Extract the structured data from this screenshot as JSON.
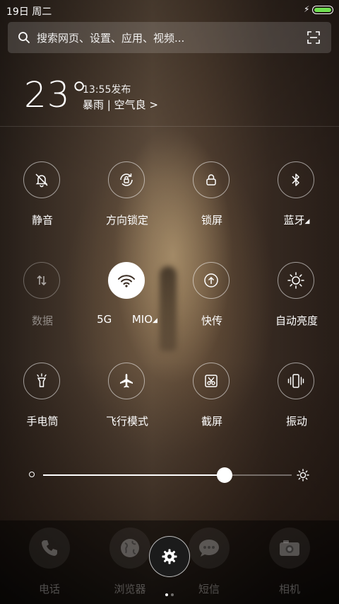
{
  "status_bar": {
    "date_day": "19日 周二"
  },
  "search": {
    "placeholder": "搜索网页、设置、应用、视频..."
  },
  "weather": {
    "temperature": "23°",
    "publish_time": "13:55发布",
    "condition": "暴雨 | 空气良 >"
  },
  "toggles": [
    {
      "label": "静音",
      "icon": "mute-bell-icon",
      "state": "off"
    },
    {
      "label": "方向锁定",
      "icon": "rotation-lock-icon",
      "state": "off"
    },
    {
      "label": "锁屏",
      "icon": "lock-icon",
      "state": "off"
    },
    {
      "label": "蓝牙",
      "icon": "bluetooth-icon",
      "state": "off",
      "has_more": true
    },
    {
      "label": "数据",
      "icon": "mobile-data-icon",
      "state": "disabled"
    },
    {
      "label": "5G      MIO",
      "icon": "wifi-icon",
      "state": "on",
      "has_more": true
    },
    {
      "label": "快传",
      "icon": "quick-transfer-icon",
      "state": "off"
    },
    {
      "label": "自动亮度",
      "icon": "auto-brightness-icon",
      "state": "off"
    },
    {
      "label": "手电筒",
      "icon": "flashlight-icon",
      "state": "off"
    },
    {
      "label": "飞行模式",
      "icon": "airplane-icon",
      "state": "off"
    },
    {
      "label": "截屏",
      "icon": "screenshot-icon",
      "state": "off"
    },
    {
      "label": "振动",
      "icon": "vibrate-icon",
      "state": "off"
    }
  ],
  "brightness": {
    "level": 0.73
  },
  "dock": [
    {
      "label": "电话",
      "icon": "phone-icon"
    },
    {
      "label": "浏览器",
      "icon": "browser-globe-icon"
    },
    {
      "label": "短信",
      "icon": "message-icon"
    },
    {
      "label": "相机",
      "icon": "camera-icon"
    }
  ],
  "colors": {
    "battery": "#6fe04f",
    "accent": "#ffffff"
  }
}
